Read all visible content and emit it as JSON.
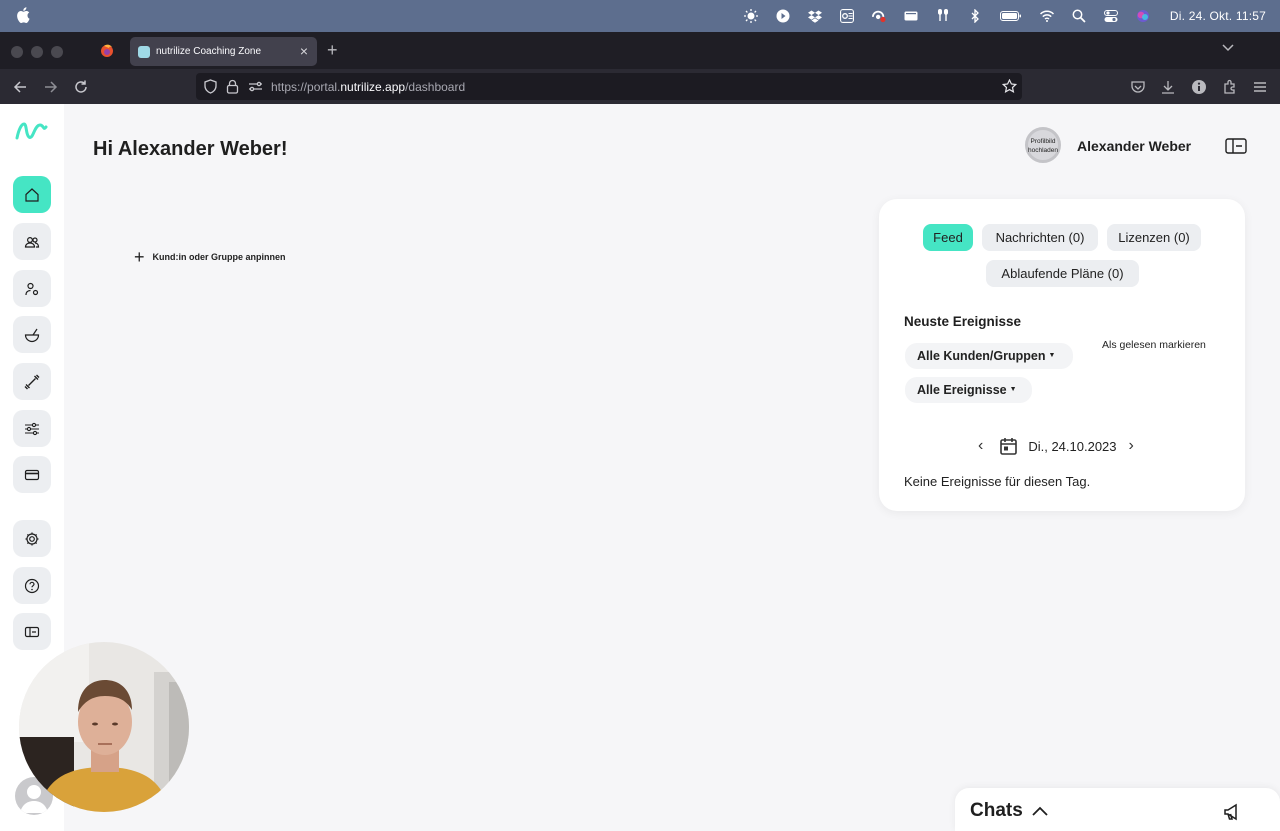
{
  "system": {
    "clock": "Di. 24. Okt.  11:57",
    "icons": [
      "apple-icon",
      "brightness-icon",
      "play-icon",
      "dropbox-icon",
      "outlook-icon",
      "record-icon",
      "display-icon",
      "airpods-icon",
      "bluetooth-icon",
      "battery-icon",
      "wifi-icon",
      "spotlight-icon",
      "control-center-icon",
      "siri-icon"
    ]
  },
  "browser": {
    "tab_title": "nutrilize Coaching Zone",
    "tab_close": "×",
    "new_tab": "+",
    "url_prefix": "https://portal.",
    "url_domain": "nutrilize.app",
    "url_path": "/dashboard"
  },
  "app": {
    "greeting": "Hi Alexander Weber!",
    "pin_icon": "+",
    "pin_label": "Kund:in oder Gruppe anpinnen",
    "avatar_text": "Profilbild hochladen",
    "user_name": "Alexander Weber",
    "accent_color": "#45e5c4",
    "sidebar": [
      "home-icon",
      "users-icon",
      "user-settings-icon",
      "bowl-icon",
      "dumbbell-icon",
      "sliders-icon",
      "credit-card-icon",
      "gear-icon",
      "help-icon",
      "logout-icon"
    ]
  },
  "feed": {
    "tabs": [
      "Feed",
      "Nachrichten (0)",
      "Lizenzen (0)",
      "Ablaufende Pläne (0)"
    ],
    "section_title": "Neuste Ereignisse",
    "mark_read": "Als gelesen markieren",
    "filter_customers": "Alle Kunden/Gruppen",
    "filter_events": "Alle Ereignisse",
    "caret": "▼",
    "date": "Di., 24.10.2023",
    "prev": "‹",
    "next": "›",
    "empty": "Keine Ereignisse für diesen Tag."
  },
  "chats": {
    "label": "Chats"
  }
}
